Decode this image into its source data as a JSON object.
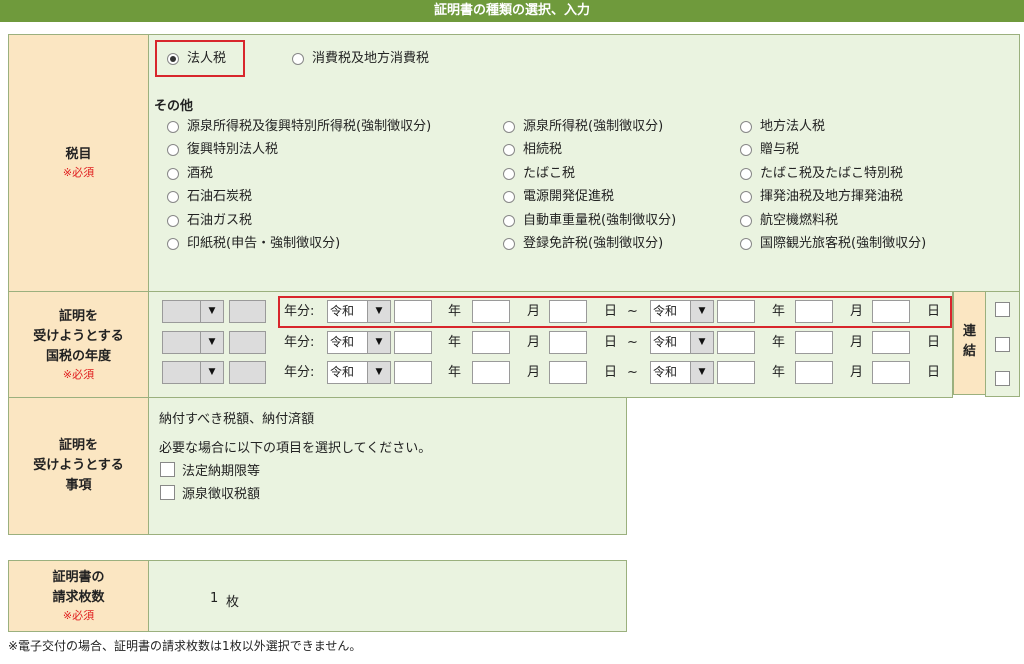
{
  "title": "証明書の種類の選択、入力",
  "required_mark": "※必須",
  "tax_item": {
    "label": "税目",
    "top_options": [
      {
        "label": "法人税",
        "selected": true
      },
      {
        "label": "消費税及地方消費税",
        "selected": false
      }
    ],
    "other_heading": "その他",
    "other_options": [
      [
        "源泉所得税及復興特別所得税(強制徴収分)",
        "源泉所得税(強制徴収分)",
        "地方法人税"
      ],
      [
        "復興特別法人税",
        "相続税",
        "贈与税"
      ],
      [
        "酒税",
        "たばこ税",
        "たばこ税及たばこ特別税"
      ],
      [
        "石油石炭税",
        "電源開発促進税",
        "揮発油税及地方揮発油税"
      ],
      [
        "石油ガス税",
        "自動車重量税(強制徴収分)",
        "航空機燃料税"
      ],
      [
        "印紙税(申告・強制徴収分)",
        "登録免許税(強制徴収分)",
        "国際観光旅客税(強制徴収分)"
      ]
    ]
  },
  "year": {
    "label_lines": [
      "証明を",
      "受けようとする",
      "国税の年度"
    ],
    "row_label": "年分:",
    "era_value": "令和",
    "unit_year": "年",
    "unit_month": "月",
    "unit_day": "日",
    "tilde": "~",
    "rows": 3,
    "renketsu_lines": [
      "連",
      "結"
    ]
  },
  "matter": {
    "label_lines": [
      "証明を",
      "受けようとする",
      "事項"
    ],
    "line1": "納付すべき税額、納付済額",
    "line2": "必要な場合に以下の項目を選択してください。",
    "options": [
      "法定納期限等",
      "源泉徴収税額"
    ]
  },
  "count": {
    "label_lines": [
      "証明書の",
      "請求枚数"
    ],
    "value": "1",
    "unit": "枚"
  },
  "footnote": "※電子交付の場合、証明書の請求枚数は1枚以外選択できません。"
}
